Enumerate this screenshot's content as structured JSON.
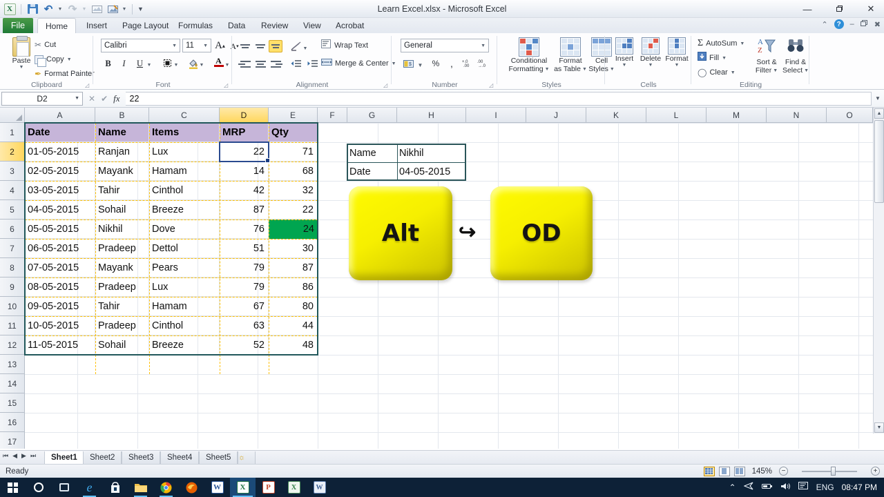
{
  "titlebar": {
    "title": "Learn Excel.xlsx  -  Microsoft Excel",
    "quick_access": [
      {
        "name": "excel-logo-icon",
        "label": "X"
      },
      {
        "name": "save-icon",
        "label": "Save"
      },
      {
        "name": "undo-icon",
        "label": "↶"
      },
      {
        "name": "redo-icon",
        "label": "↷"
      },
      {
        "name": "print-preview-icon",
        "label": "Print Preview"
      },
      {
        "name": "quick-print-icon",
        "label": "Quick Print"
      },
      {
        "name": "customize-qat-icon",
        "label": "☰"
      }
    ],
    "window_controls": {
      "minimize": "—",
      "restore": "❐",
      "close": "✕"
    },
    "ribbon_controls": {
      "collapse": "⌃",
      "help": "?",
      "min2": "–",
      "restore2": "❐",
      "close2": "✖"
    }
  },
  "tabs": [
    {
      "label": "File"
    },
    {
      "label": "Home"
    },
    {
      "label": "Insert"
    },
    {
      "label": "Page Layout"
    },
    {
      "label": "Formulas"
    },
    {
      "label": "Data"
    },
    {
      "label": "Review"
    },
    {
      "label": "View"
    },
    {
      "label": "Acrobat"
    }
  ],
  "ribbon": {
    "clipboard": {
      "label": "Clipboard",
      "paste": "Paste",
      "cut": "Cut",
      "copy": "Copy",
      "format_painter": "Format Painter"
    },
    "font": {
      "label": "Font",
      "font_name": "Calibri",
      "font_size": "11",
      "grow": "A",
      "shrink": "A",
      "bold": "B",
      "italic": "I",
      "underline": "U",
      "borders": "Borders",
      "fill_color": "Fill Color",
      "font_color": "A"
    },
    "alignment": {
      "label": "Alignment",
      "wrap_text": "Wrap Text",
      "merge_center": "Merge & Center",
      "orientation": "Orientation",
      "decrease_indent": "Decrease Indent",
      "increase_indent": "Increase Indent"
    },
    "number": {
      "label": "Number",
      "format": "General",
      "accounting": "Accounting Number Format",
      "percent": "%",
      "comma": ",",
      "increase_decimal": "Increase Decimal",
      "decrease_decimal": "Decrease Decimal"
    },
    "styles": {
      "label": "Styles",
      "conditional_formatting": "Conditional\nFormatting",
      "conditional_formatting_l1": "Conditional",
      "conditional_formatting_l2": "Formatting",
      "format_as_table_l1": "Format",
      "format_as_table_l2": "as Table",
      "cell_styles_l1": "Cell",
      "cell_styles_l2": "Styles"
    },
    "cells": {
      "label": "Cells",
      "insert": "Insert",
      "delete": "Delete",
      "format": "Format"
    },
    "editing": {
      "label": "Editing",
      "autosum": "AutoSum",
      "fill": "Fill",
      "clear": "Clear",
      "sort_filter_l1": "Sort &",
      "sort_filter_l2": "Filter",
      "find_select_l1": "Find &",
      "find_select_l2": "Select"
    }
  },
  "formula_bar": {
    "name_box": "D2",
    "formula": "22",
    "cancel": "✕",
    "enter": "✔",
    "fx": "fx"
  },
  "grid": {
    "columns": [
      "A",
      "B",
      "C",
      "D",
      "E",
      "F",
      "G",
      "H",
      "I",
      "J",
      "K",
      "L",
      "M",
      "N",
      "O"
    ],
    "selected_column": "D",
    "rows": [
      "1",
      "2",
      "3",
      "4",
      "5",
      "6",
      "7",
      "8",
      "9",
      "10",
      "11",
      "12",
      "13",
      "14",
      "15",
      "16",
      "17"
    ],
    "selected_row": "2",
    "headers": [
      "Date",
      "Name",
      "Items",
      "MRP",
      "Qty"
    ],
    "data": [
      {
        "row": "2",
        "date": "01-05-2015",
        "name": "Ranjan",
        "item": "Lux",
        "mrp": "22",
        "qty": "71"
      },
      {
        "row": "3",
        "date": "02-05-2015",
        "name": "Mayank",
        "item": "Hamam",
        "mrp": "14",
        "qty": "68"
      },
      {
        "row": "4",
        "date": "03-05-2015",
        "name": "Tahir",
        "item": "Cinthol",
        "mrp": "42",
        "qty": "32"
      },
      {
        "row": "5",
        "date": "04-05-2015",
        "name": "Sohail",
        "item": "Breeze",
        "mrp": "87",
        "qty": "22"
      },
      {
        "row": "6",
        "date": "05-05-2015",
        "name": "Nikhil",
        "item": "Dove",
        "mrp": "76",
        "qty": "24"
      },
      {
        "row": "7",
        "date": "06-05-2015",
        "name": "Pradeep",
        "item": "Dettol",
        "mrp": "51",
        "qty": "30"
      },
      {
        "row": "8",
        "date": "07-05-2015",
        "name": "Mayank",
        "item": "Pears",
        "mrp": "79",
        "qty": "87"
      },
      {
        "row": "9",
        "date": "08-05-2015",
        "name": "Pradeep",
        "item": "Lux",
        "mrp": "79",
        "qty": "86"
      },
      {
        "row": "10",
        "date": "09-05-2015",
        "name": "Tahir",
        "item": "Hamam",
        "mrp": "67",
        "qty": "80"
      },
      {
        "row": "11",
        "date": "10-05-2015",
        "name": "Pradeep",
        "item": "Cinthol",
        "mrp": "63",
        "qty": "44"
      },
      {
        "row": "12",
        "date": "11-05-2015",
        "name": "Sohail",
        "item": "Breeze",
        "mrp": "52",
        "qty": "48"
      }
    ],
    "highlighted_cell": {
      "ref": "E6",
      "value": "24",
      "fill": "#00a550"
    },
    "active_cell": {
      "ref": "D2",
      "value": "22"
    },
    "lookup_box": {
      "name_label": "Name",
      "name_value": "Nikhil",
      "date_label": "Date",
      "date_value": "04-05-2015"
    },
    "colors": {
      "header_fill": "#c6b5d9",
      "copy_marquee": "#ffc000",
      "selection": "#2a4a8f",
      "range_border": "#20575a",
      "green_fill": "#00a550"
    }
  },
  "overlay_keys": {
    "key1": "Alt",
    "arrow": "↪",
    "key2": "OD",
    "key_color": "#fffb00"
  },
  "sheet_tabs": {
    "nav": [
      "⏮",
      "◀",
      "▶",
      "⏭"
    ],
    "sheets": [
      "Sheet1",
      "Sheet2",
      "Sheet3",
      "Sheet4",
      "Sheet5"
    ],
    "active": "Sheet1",
    "insert_sheet": "Insert Worksheet"
  },
  "status_bar": {
    "status": "Ready",
    "views": [
      "Normal",
      "Page Layout",
      "Page Break Preview"
    ],
    "active_view": "Normal",
    "zoom": "145%",
    "zoom_out": "−",
    "zoom_in": "+"
  },
  "taskbar": {
    "items": [
      {
        "name": "start-button",
        "label": "Start"
      },
      {
        "name": "cortana-search-icon",
        "label": "Search"
      },
      {
        "name": "task-view-icon",
        "label": "Task View"
      },
      {
        "name": "edge-icon",
        "label": "e"
      },
      {
        "name": "store-icon",
        "label": "Store"
      },
      {
        "name": "file-explorer-icon",
        "label": "Files"
      },
      {
        "name": "chrome-icon",
        "label": "Chrome"
      },
      {
        "name": "firefox-icon",
        "label": "Firefox"
      },
      {
        "name": "word-icon",
        "label": "W"
      },
      {
        "name": "excel-icon",
        "label": "X"
      },
      {
        "name": "powerpoint-icon",
        "label": "P"
      },
      {
        "name": "excel-alt-icon",
        "label": "X"
      },
      {
        "name": "word-alt-icon",
        "label": "W"
      }
    ],
    "tray": {
      "show_hidden": "⌃",
      "network": "Network",
      "battery": "Battery",
      "volume": "Volume",
      "action_center": "Notifications",
      "language": "ENG",
      "time": "08:47 PM"
    }
  }
}
